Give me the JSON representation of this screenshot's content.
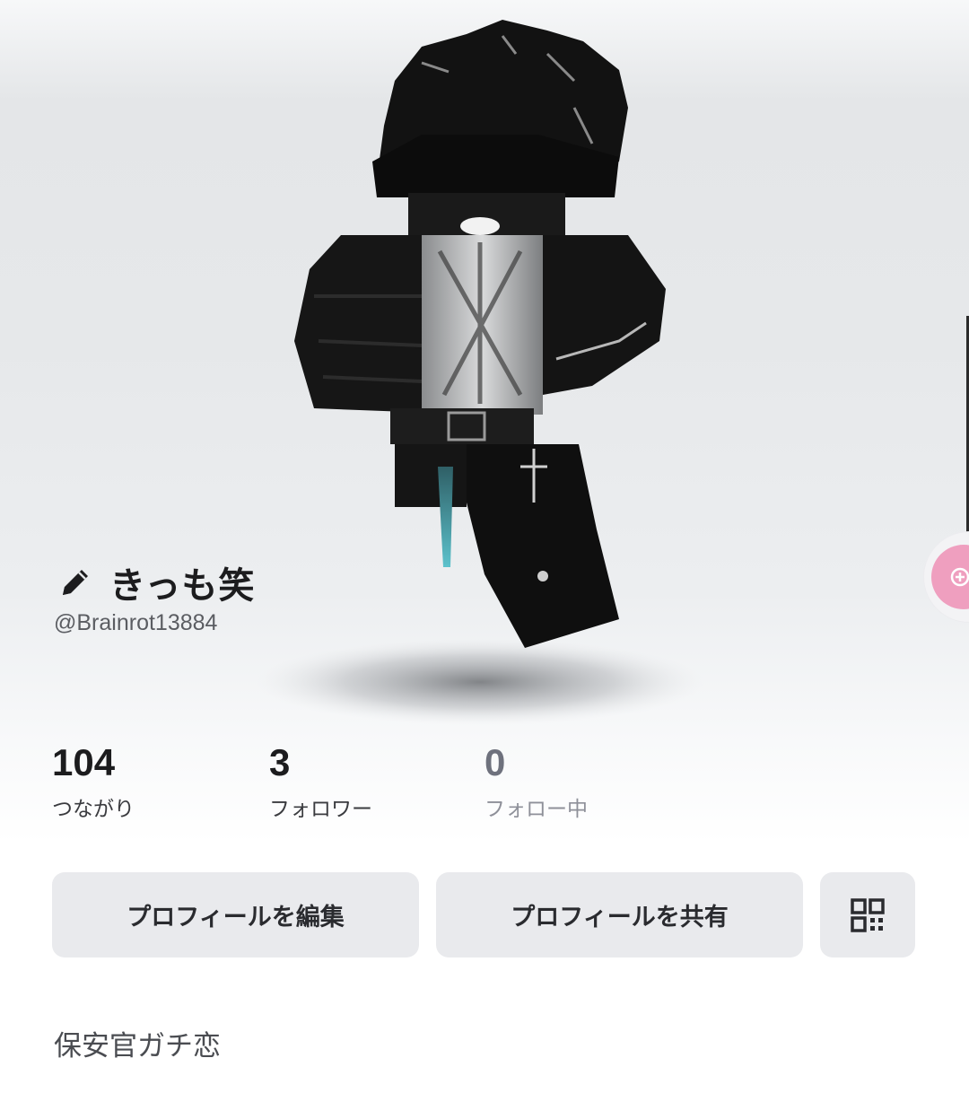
{
  "profile": {
    "display_name": "きっも笑",
    "username": "@Brainrot13884",
    "bio": "保安官ガチ恋"
  },
  "stats": [
    {
      "value": "104",
      "label": "つながり"
    },
    {
      "value": "3",
      "label": "フォロワー"
    },
    {
      "value": "0",
      "label": "フォロー中"
    }
  ],
  "actions": {
    "edit_profile": "プロフィールを編集",
    "share_profile": "プロフィールを共有"
  },
  "icons": {
    "edit": "pencil-icon",
    "qr": "qr-code-icon",
    "side_tab": "add-icon"
  },
  "colors": {
    "side_tab_accent": "#ef9fbf",
    "button_bg": "#e9eaed"
  }
}
